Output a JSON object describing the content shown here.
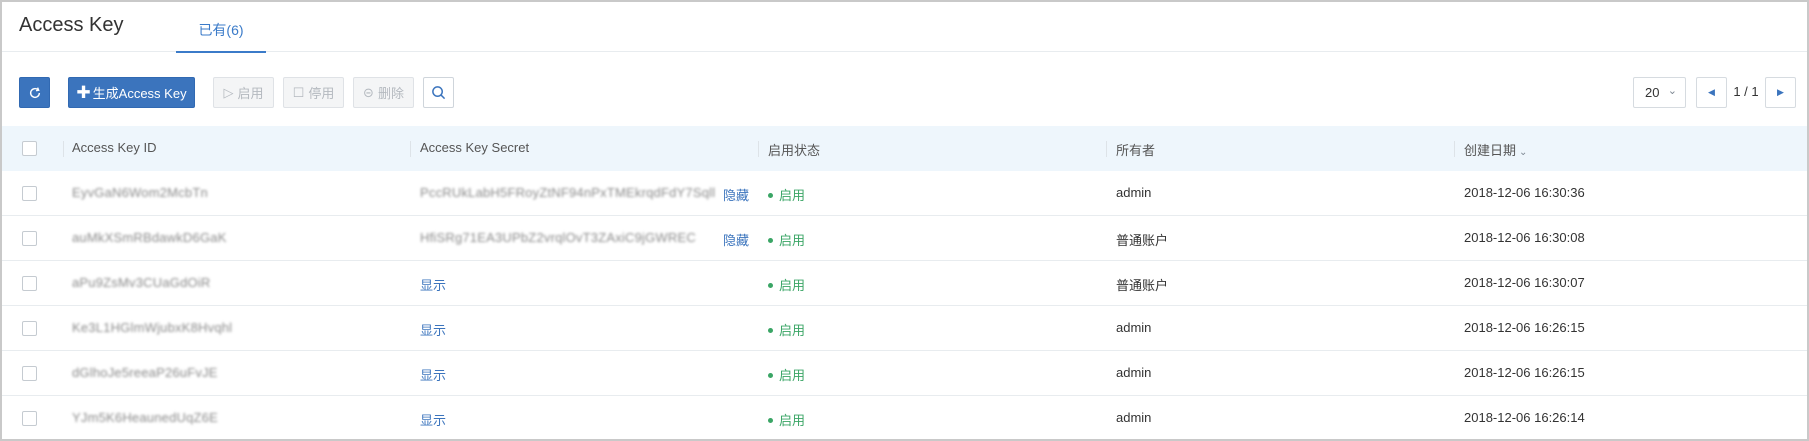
{
  "header": {
    "title": "Access Key",
    "tab_label": "已有(6)"
  },
  "toolbar": {
    "refresh_icon": "refresh-icon",
    "generate_label": "生成Access Key",
    "generate_icon": "plus-icon",
    "enable_label": "启用",
    "enable_icon": "play-icon",
    "disable_label": "停用",
    "disable_icon": "stop-icon",
    "delete_label": "删除",
    "delete_icon": "minus-circle-icon",
    "search_icon": "search-icon"
  },
  "pagination": {
    "page_size": "20",
    "page_indicator": "1 / 1"
  },
  "table": {
    "columns": {
      "id": "Access Key ID",
      "secret": "Access Key Secret",
      "status": "启用状态",
      "owner": "所有者",
      "created": "创建日期"
    },
    "rows": [
      {
        "id": "EyvGaN6Wom2McbTn",
        "secret": "PccRUkLabH5FRoyZtNF94nPxTMEkrqdFdY7Sqll",
        "secret_action": "隐藏",
        "status": "启用",
        "owner": "admin",
        "created": "2018-12-06 16:30:36"
      },
      {
        "id": "auMkXSmRBdawkD6GaK",
        "secret": "HfiSRg71EA3UPbZ2vrqlOvT3ZAxiC9jGWREC",
        "secret_action": "隐藏",
        "status": "启用",
        "owner": "普通账户",
        "created": "2018-12-06 16:30:08"
      },
      {
        "id": "aPu9ZsMv3CUaGdOiR",
        "secret": "显示",
        "secret_action": "",
        "status": "启用",
        "owner": "普通账户",
        "created": "2018-12-06 16:30:07"
      },
      {
        "id": "Ke3L1HGlmWjubxK8Hvqhl",
        "secret": "显示",
        "secret_action": "",
        "status": "启用",
        "owner": "admin",
        "created": "2018-12-06 16:26:15"
      },
      {
        "id": "dGlhoJe5reeaP26uFvJE",
        "secret": "显示",
        "secret_action": "",
        "status": "启用",
        "owner": "admin",
        "created": "2018-12-06 16:26:15"
      },
      {
        "id": "YJm5K6HeaunedUqZ6E",
        "secret": "显示",
        "secret_action": "",
        "status": "启用",
        "owner": "admin",
        "created": "2018-12-06 16:26:14"
      }
    ]
  },
  "colors": {
    "primary": "#3b74bd",
    "status_green": "#3aa565",
    "header_bg": "#eef6fc"
  }
}
